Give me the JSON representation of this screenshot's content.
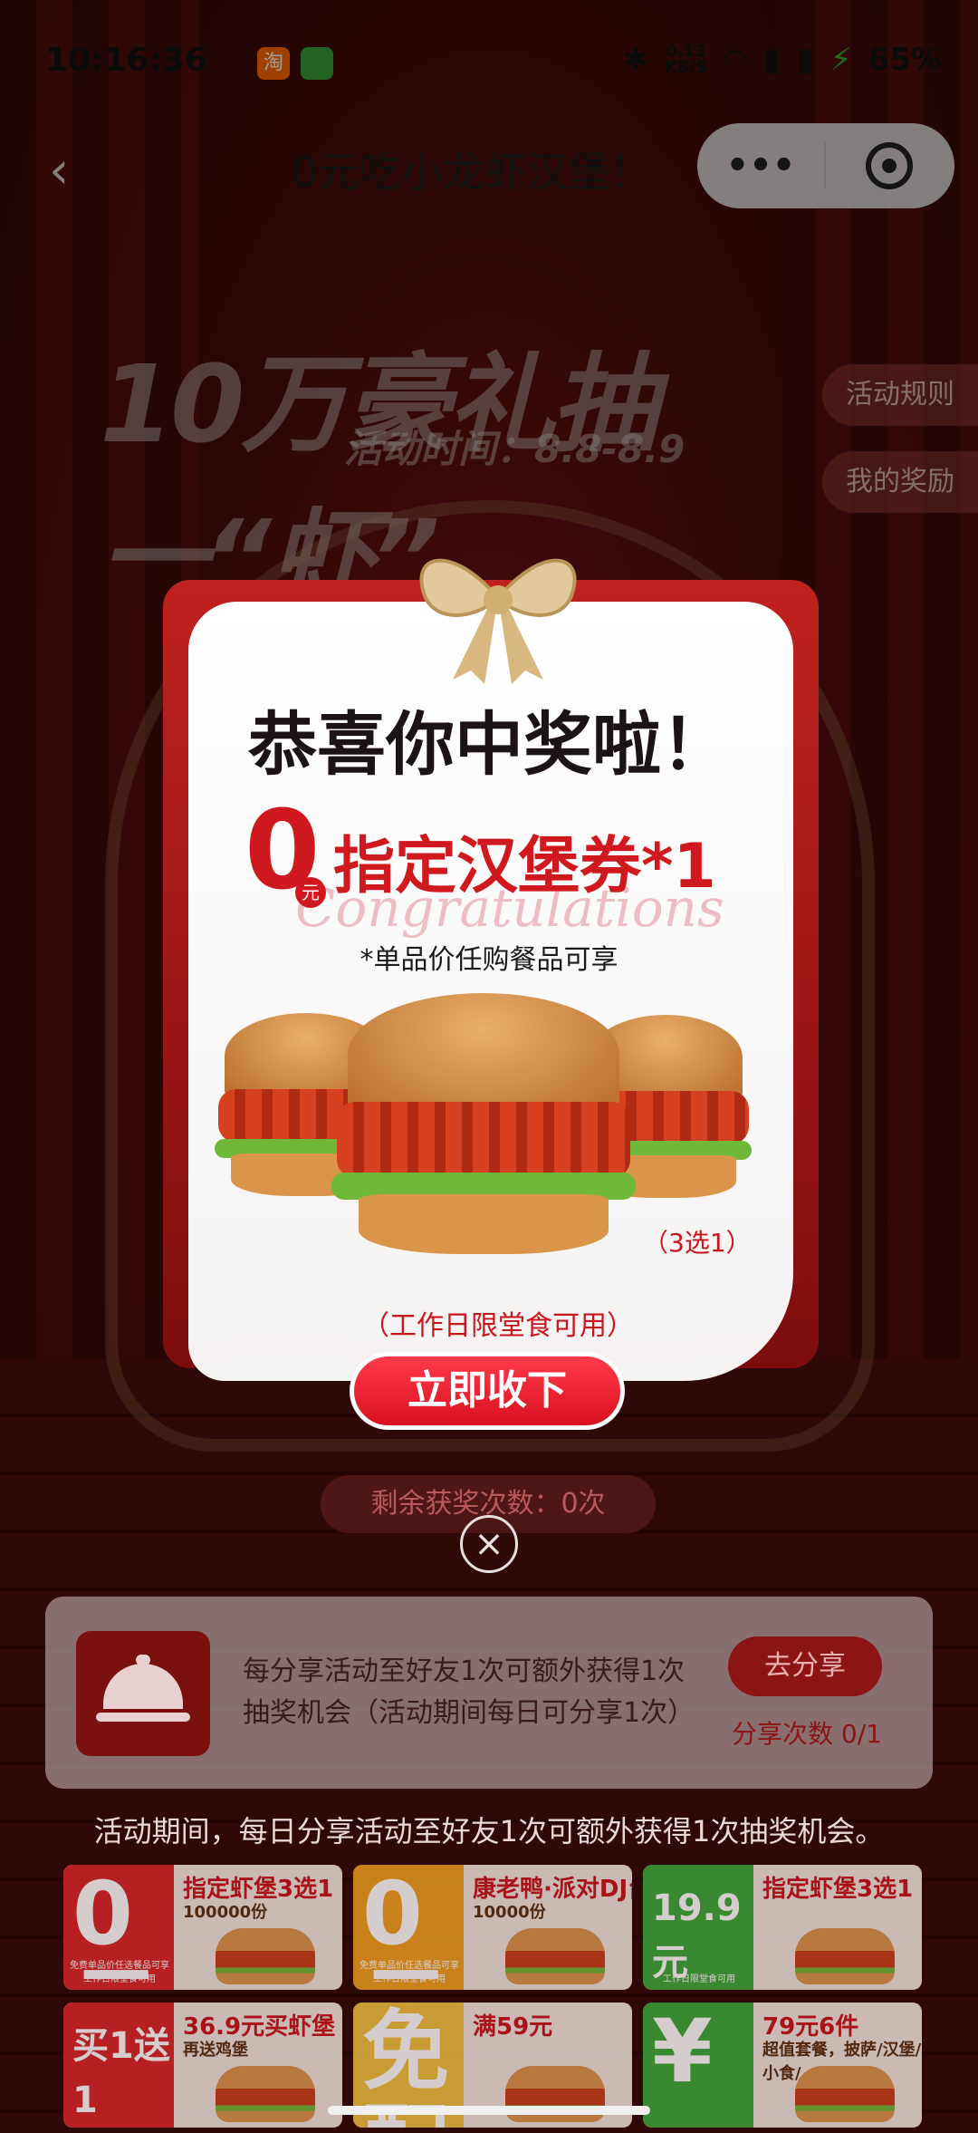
{
  "status_bar": {
    "time": "10:16:36",
    "net_speed_value": "0.13",
    "net_speed_unit": "KB/S",
    "battery": "65%"
  },
  "nav": {
    "title": "0元吃小龙虾汉堡！"
  },
  "background": {
    "headline": "10万豪礼抽一“虾”",
    "event_time": "活动时间：8.8-8.9",
    "rules_button": "活动规则",
    "my_prizes_button": "我的奖励"
  },
  "modal": {
    "congrats": "恭喜你中奖啦！",
    "prize_value": "0",
    "prize_unit": "元",
    "prize_name": "指定汉堡券*1",
    "watermark": "Congratulations",
    "prize_note": "*单品价任购餐品可享",
    "choose_note": "（3选1）",
    "limit_note": "（工作日限堂食可用）",
    "claim_button": "立即收下"
  },
  "remaining_draws": "剩余获奖次数：0次",
  "share": {
    "text": "每分享活动至好友1次可额外获得1次抽奖机会（活动期间每日可分享1次）",
    "button": "去分享",
    "count": "分享次数 0/1"
  },
  "period_note": "活动期间，每日分享活动至好友1次可额外获得1次抽奖机会。",
  "tiles": [
    {
      "big": "0元",
      "name": "指定虾堡3选1",
      "sub": "100000份",
      "small": "免费单品价任选餐品可享 工作日限堂食可用",
      "color": "#d8262a"
    },
    {
      "big": "0元",
      "name": "康老鸭·派对DJ台",
      "sub": "10000份",
      "small": "免费单品价任选餐品可享 工作日限堂食可用",
      "color": "#f0a020"
    },
    {
      "big": "19.9元",
      "name": "指定虾堡3选1",
      "sub": "",
      "small": "工作日限堂食可用",
      "color": "#3caa3c"
    },
    {
      "big": "买1送1",
      "name": "36.9元买虾堡",
      "sub": "再送鸡堡",
      "small": "",
      "color": "#d8262a"
    },
    {
      "big": "免配",
      "name": "满59元",
      "sub": "",
      "small": "",
      "color": "#f0c040"
    },
    {
      "big": "¥",
      "name": "79元6件",
      "sub": "超值套餐，披萨/汉堡/小食/",
      "small": "",
      "color": "#3caa3c"
    }
  ]
}
